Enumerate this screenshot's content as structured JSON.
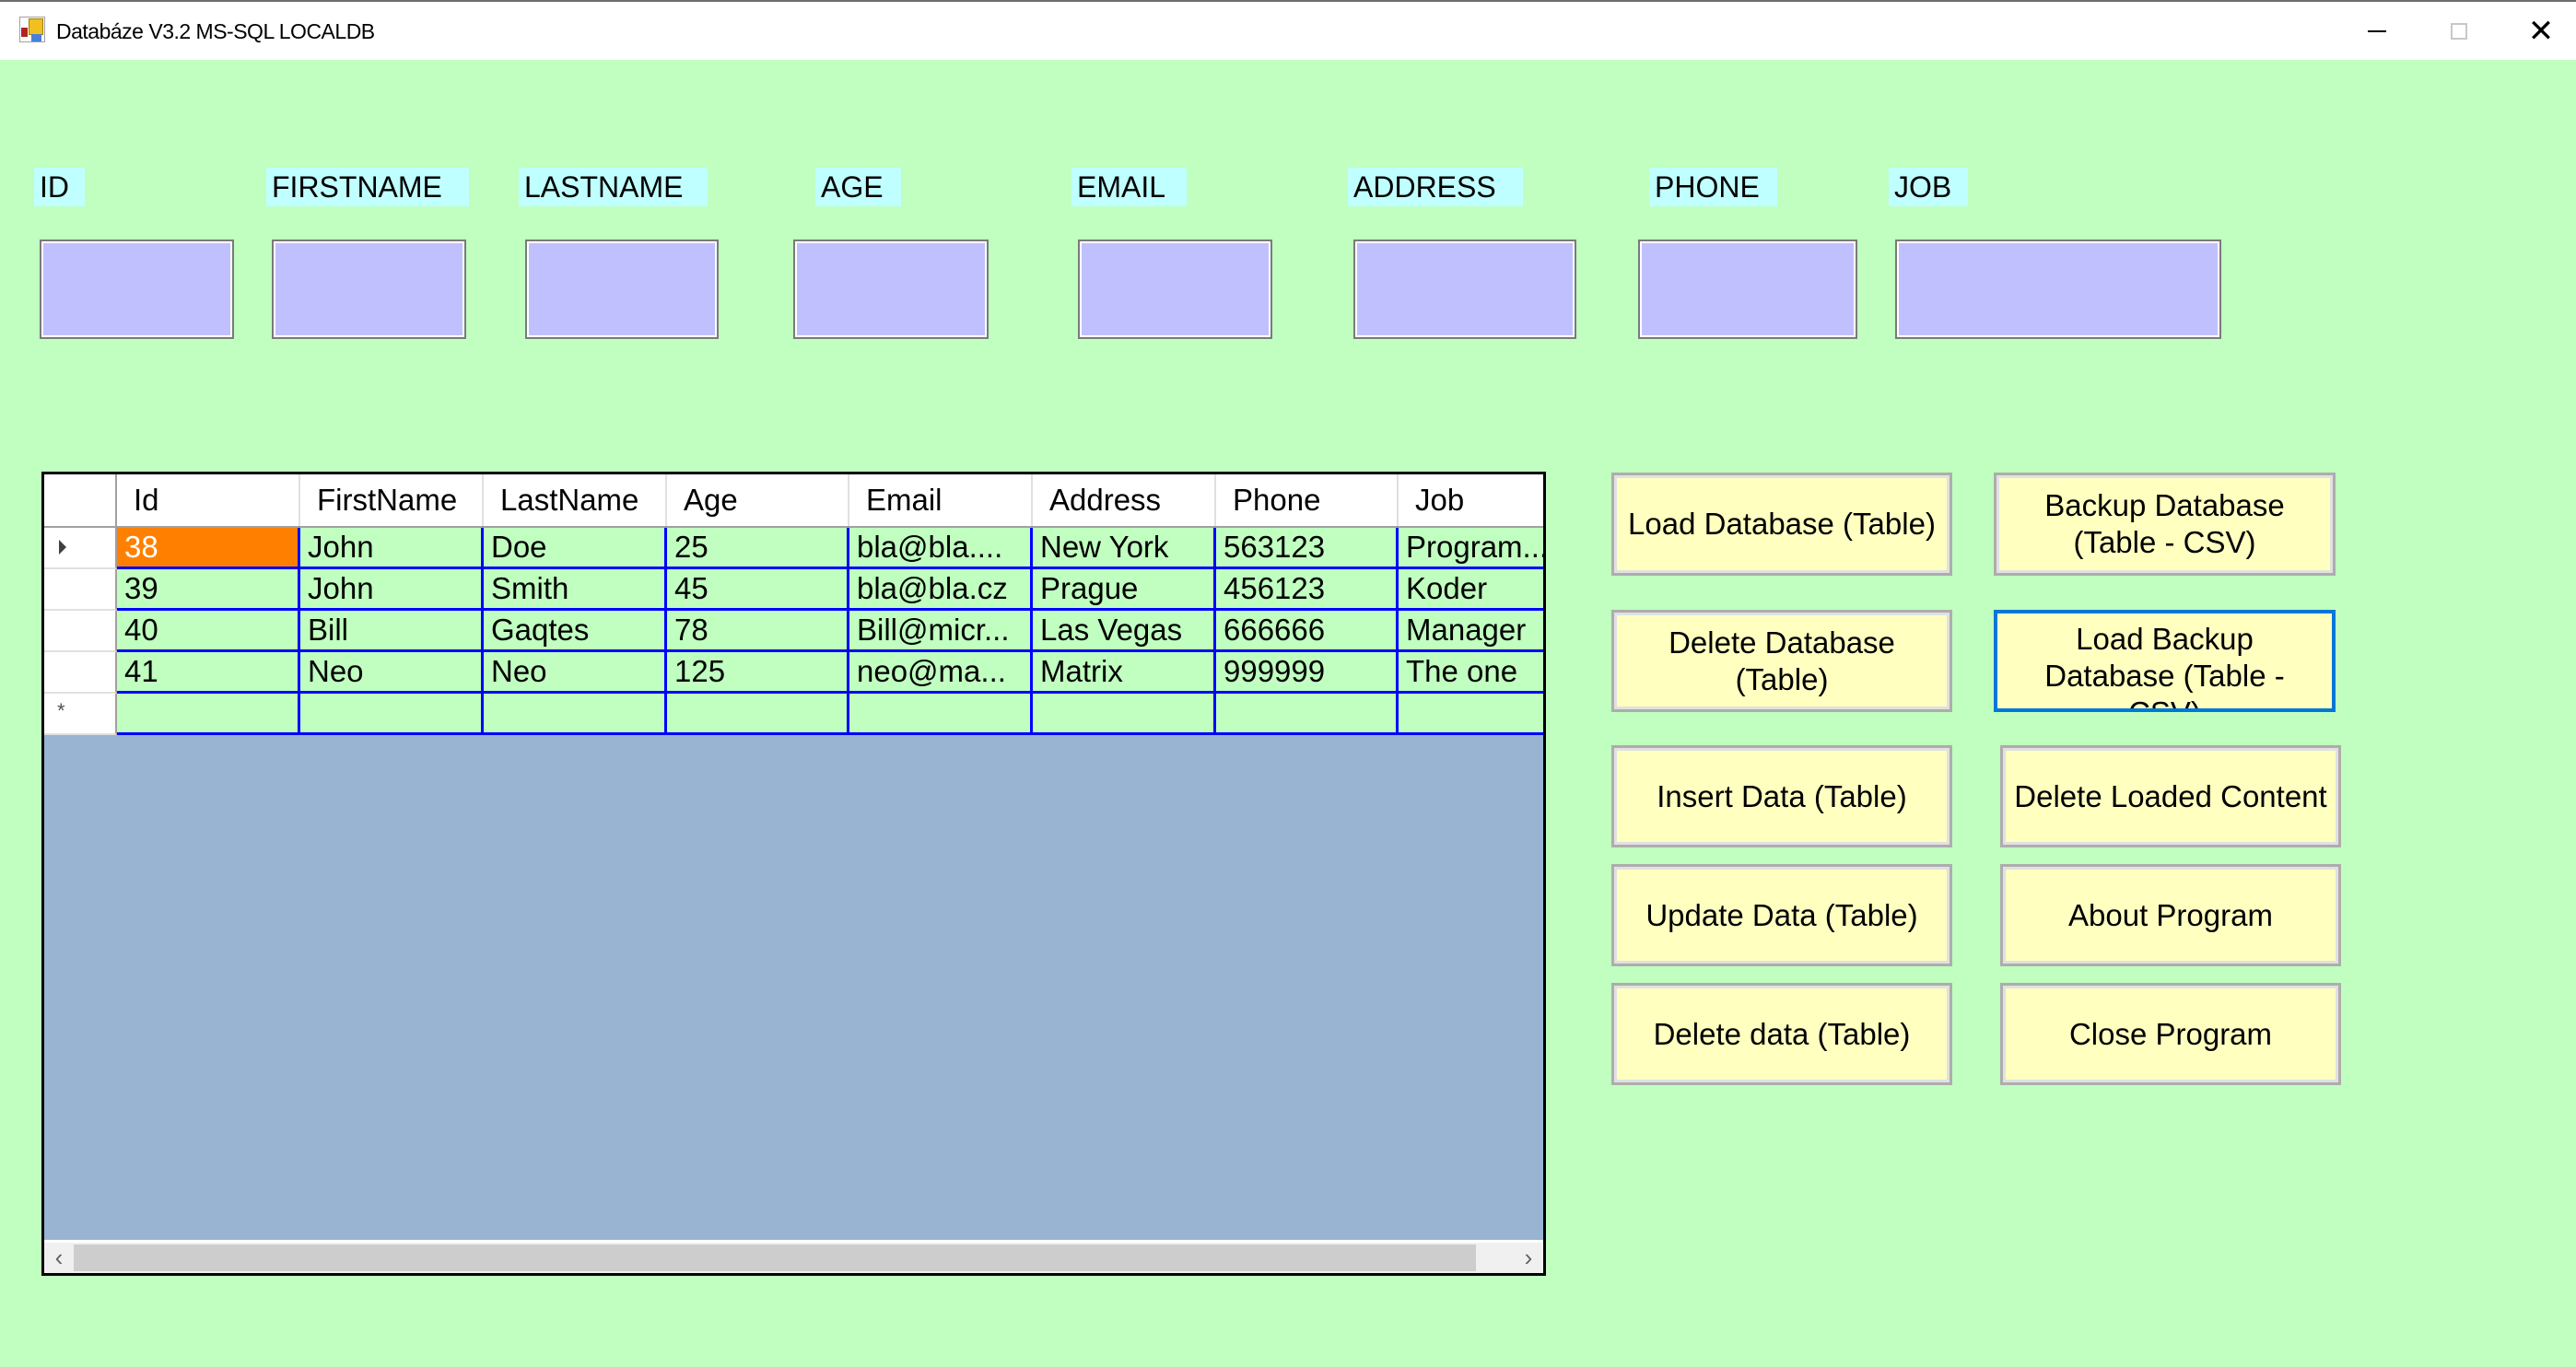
{
  "window": {
    "title": "Databáze V3.2 MS-SQL LOCALDB",
    "icon": "app-database-icon",
    "controls": {
      "minimize": "minimize-icon",
      "maximize": "maximize-icon",
      "close": "close-icon"
    },
    "close_glyph": "✕"
  },
  "form": {
    "fields": [
      {
        "label": "ID",
        "value": ""
      },
      {
        "label": "FIRSTNAME",
        "value": ""
      },
      {
        "label": "LASTNAME",
        "value": ""
      },
      {
        "label": "AGE",
        "value": ""
      },
      {
        "label": "EMAIL",
        "value": ""
      },
      {
        "label": "ADDRESS",
        "value": ""
      },
      {
        "label": "PHONE",
        "value": ""
      },
      {
        "label": "JOB",
        "value": ""
      }
    ]
  },
  "grid": {
    "columns": [
      "Id",
      "FirstName",
      "LastName",
      "Age",
      "Email",
      "Address",
      "Phone",
      "Job"
    ],
    "rows": [
      [
        "38",
        "John",
        "Doe",
        "25",
        "bla@bla....",
        "New York",
        "563123",
        "Program..."
      ],
      [
        "39",
        "John",
        "Smith",
        "45",
        "bla@bla.cz",
        "Prague",
        "456123",
        "Koder"
      ],
      [
        "40",
        "Bill",
        "Gaqtes",
        "78",
        "Bill@micr...",
        "Las Vegas",
        "666666",
        "Manager"
      ],
      [
        "41",
        "Neo",
        "Neo",
        "125",
        "neo@ma...",
        "Matrix",
        "999999",
        "The one"
      ]
    ],
    "selected_row": 0,
    "selected_cell_color": "#ff8000",
    "new_row_marker": "*",
    "current_row_marker": "row-pointer-icon",
    "scroll": {
      "left_arrow": "‹",
      "right_arrow": "›"
    }
  },
  "buttons": {
    "load_database": "Load Database (Table)",
    "backup_database": "Backup Database (Table - CSV)",
    "delete_database": "Delete Database (Table)",
    "load_backup": "Load Backup Database (Table - CSV)",
    "insert_data": "Insert Data (Table)",
    "delete_loaded": "Delete Loaded Content",
    "update_data": "Update Data (Table)",
    "about_program": "About Program",
    "delete_data": "Delete data (Table)",
    "close_program": "Close Program"
  },
  "colors": {
    "form_background": "#c0ffc0",
    "label_background": "#c0ffff",
    "input_background": "#c0c0ff",
    "button_background": "#ffffc0",
    "grid_background": "#98b4d2",
    "grid_line": "#0000ff",
    "focus_border": "#0078d7"
  }
}
